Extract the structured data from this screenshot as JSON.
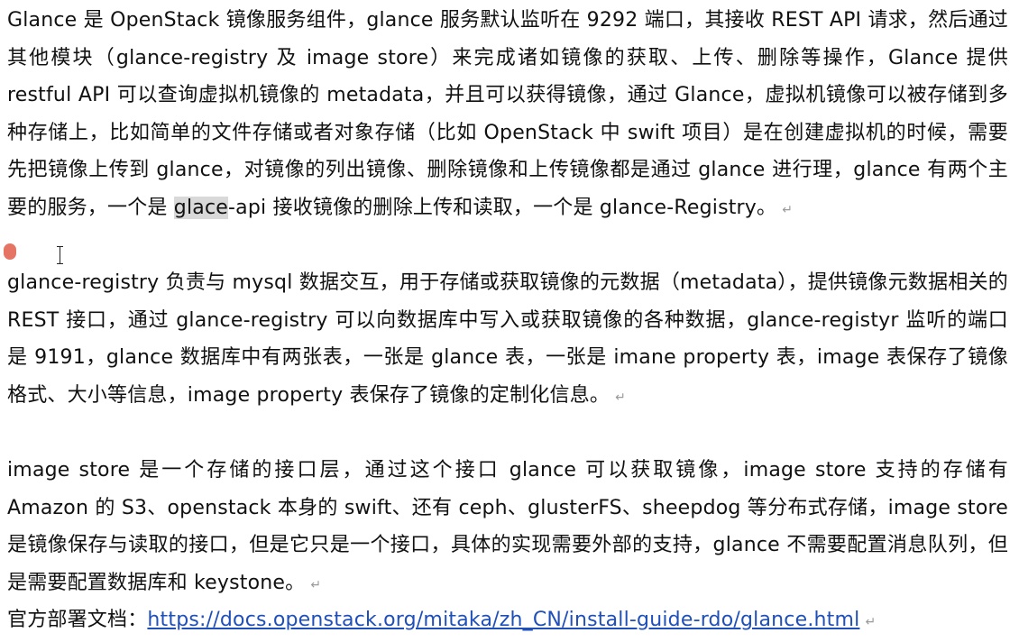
{
  "doc": {
    "paragraph_1": {
      "text": "Glance 是 OpenStack 镜像服务组件，glance 服务默认监听在 9292 端口，其接收 REST API 请求，然后通过其他模块（glance-registry 及 image store）来完成诸如镜像的获取、上传、删除等操作，Glance 提供 restful API 可以查询虚拟机镜像的 metadata，并且可以获得镜像，通过 Glance，虚拟机镜像可以被存储到多种存储上，比如简单的文件存储或者对象存储（比如 OpenStack 中 swift 项目）是在创建虚拟机的时候，需要先把镜像上传到 glance，对镜像的列出镜像、删除镜像和上传镜像都是通过 glance 进行理，glance 有两个主要的服务，一个是 ",
      "selected": "glace",
      "after": "-api 接收镜像的删除上传和读取，一个是 glance-Registry。"
    },
    "paragraph_2": "glance-registry 负责与 mysql 数据交互，用于存储或获取镜像的元数据（metadata），提供镜像元数据相关的 REST 接口，通过 glance-registry 可以向数据库中写入或获取镜像的各种数据，glance-registyr 监听的端口是 9191，glance 数据库中有两张表，一张是 glance 表，一张是 imane property 表，image 表保存了镜像格式、大小等信息，image property 表保存了镜像的定制化信息。",
    "paragraph_3": "image store 是一个存储的接口层，通过这个接口 glance 可以获取镜像，image store 支持的存储有 Amazon 的 S3、openstack 本身的 swift、还有 ceph、glusterFS、sheepdog 等分布式存储，image store 是镜像保存与读取的接口，但是它只是一个接口，具体的实现需要外部的支持，glance 不需要配置消息队列，但是需要配置数据库和 keystone。",
    "doc_label": "官方部署文档：",
    "doc_link": "https://docs.openstack.org/mitaka/zh_CN/install-guide-rdo/glance.html",
    "paragraph_mark": "↵"
  },
  "colors": {
    "link": "#1f4fb8",
    "selection": "#d9d9d9",
    "cursor_marker": "#dc4632"
  }
}
